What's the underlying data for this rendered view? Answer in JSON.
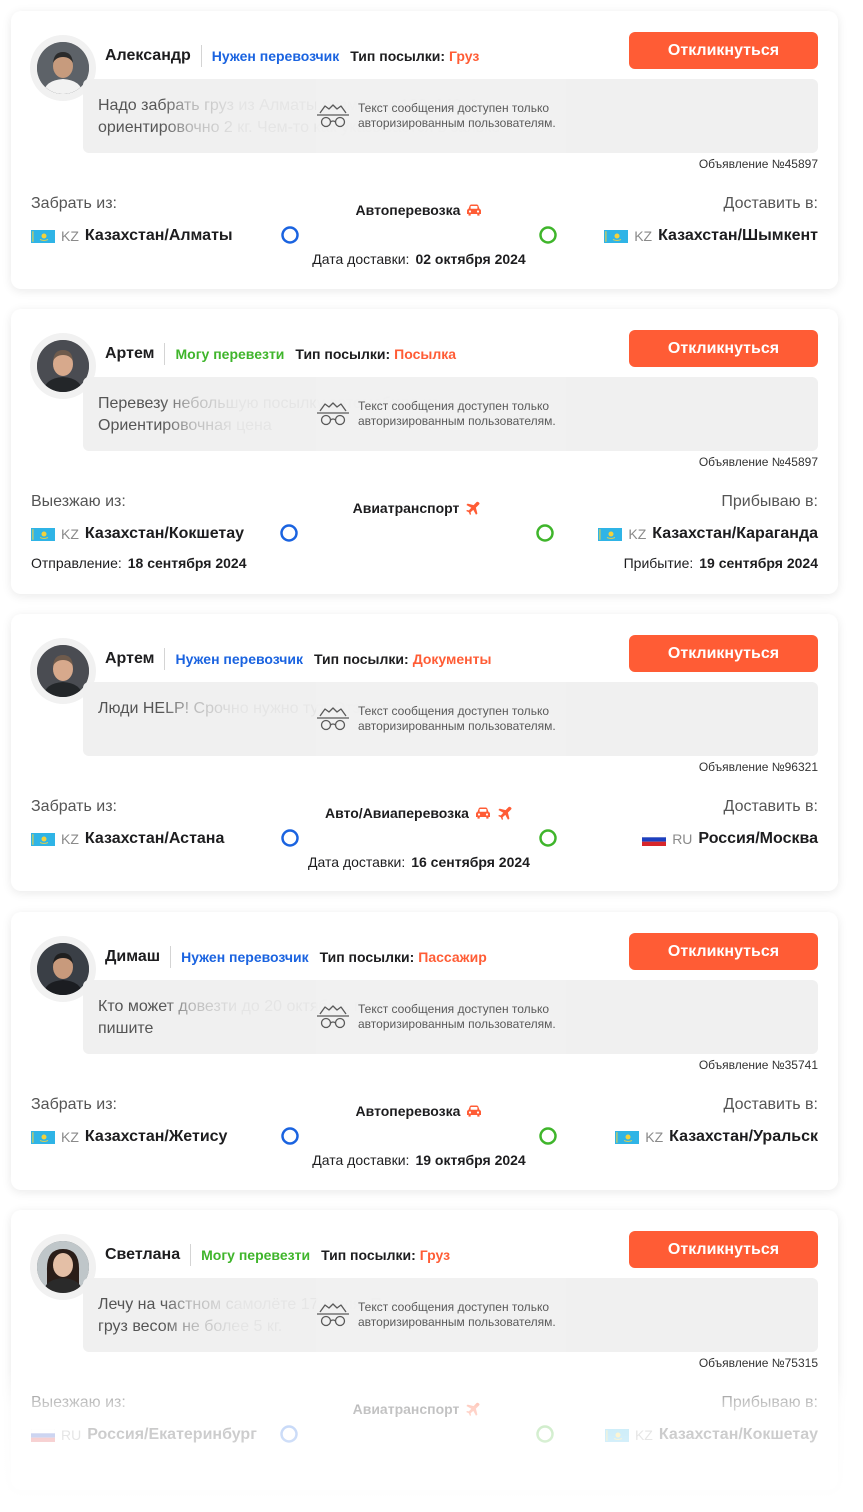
{
  "colors": {
    "accent": "#ff5c35",
    "blue_status": "#1a63e0",
    "green_status": "#3fb52b",
    "route_start": "#1a63e0",
    "route_end": "#3fb52b"
  },
  "lock_message": {
    "line1": "Текст сообщения доступен только",
    "line2": "авторизированным пользователям."
  },
  "respond_label": "Откликнуться",
  "package_type_label": "Тип посылки:",
  "listings": [
    {
      "name": "Александр",
      "status": "Нужен перевозчик",
      "status_color": "blue",
      "package_type": "Груз",
      "message_preview": "Надо забрать груз из Алматы                                                                              размером 180х140х1м",
      "message_line2": "ориентировочно 2 кг. Чем-то                                                                              как указывается в заявке",
      "ad_number": "Объявление №45897",
      "from_label": "Забрать из:",
      "to_label": "Доставить в:",
      "from": {
        "flag": "KZ",
        "code": "KZ",
        "city": "Казахстан/Алматы"
      },
      "to": {
        "flag": "KZ",
        "code": "KZ",
        "city": "Казахстан/Шымкент"
      },
      "transport": "Автоперевозка",
      "transport_icons": [
        "car-icon"
      ],
      "date_label": "Дата доставки:",
      "date": "02 октября 2024"
    },
    {
      "name": "Артем",
      "status": "Могу перевезти",
      "status_color": "green",
      "package_type": "Посылка",
      "message_preview": "Перевезу небольшую посылку                                                                             автомобиле из",
      "message_line2": "Ориентировочная цена                                                                              ",
      "ad_number": "Объявление №45897",
      "from_label": "Выезжаю из:",
      "to_label": "Прибываю в:",
      "from": {
        "flag": "KZ",
        "code": "KZ",
        "city": "Казахстан/Кокшетау"
      },
      "to": {
        "flag": "KZ",
        "code": "KZ",
        "city": "Казахстан/Караганда"
      },
      "transport": "Авиатранспорт",
      "transport_icons": [
        "plane-icon"
      ],
      "departure_label": "Отправление:",
      "departure": "18 сентября 2024",
      "arrival_label": "Прибытие:",
      "arrival": "19 сентября 2024"
    },
    {
      "name": "Артем",
      "status": "Нужен перевозчик",
      "status_color": "blue",
      "package_type": "Документы",
      "message_preview": "Люди HELP! Срочно нужно                                                                             тут. Отзовитесь",
      "message_line2": "",
      "ad_number": "Объявление №96321",
      "from_label": "Забрать из:",
      "to_label": "Доставить в:",
      "from": {
        "flag": "KZ",
        "code": "KZ",
        "city": "Казахстан/Астана"
      },
      "to": {
        "flag": "RU",
        "code": "RU",
        "city": "Россия/Москва"
      },
      "transport": "Авто/Авиаперевозка",
      "transport_icons": [
        "car-icon",
        "plane-icon"
      ],
      "date_label": "Дата доставки:",
      "date": "16 сентября 2024"
    },
    {
      "name": "Димаш",
      "status": "Нужен перевозчик",
      "status_color": "blue",
      "package_type": "Пассажир",
      "message_preview": "Кто может довезти до                                                                             20 октября, пишите мне",
      "message_line2": "пишите",
      "ad_number": "Объявление №35741",
      "from_label": "Забрать из:",
      "to_label": "Доставить в:",
      "from": {
        "flag": "KZ",
        "code": "KZ",
        "city": "Казахстан/Жетису"
      },
      "to": {
        "flag": "KZ",
        "code": "KZ",
        "city": "Казахстан/Уральск"
      },
      "transport": "Автоперевозка",
      "transport_icons": [
        "car-icon"
      ],
      "date_label": "Дата доставки:",
      "date": "19 октября 2024"
    },
    {
      "name": "Светлана",
      "status": "Могу перевезти",
      "status_color": "green",
      "package_type": "Груз",
      "message_preview": "Лечу на частном самолёте                                                                             17 июля. Перевезу",
      "message_line2": "груз весом не более 5 кг.",
      "ad_number": "Объявление №75315",
      "from_label": "Выезжаю из:",
      "to_label": "Прибываю в:",
      "from": {
        "flag": "RU",
        "code": "RU",
        "city": "Россия/Екатеринбург"
      },
      "to": {
        "flag": "KZ",
        "code": "KZ",
        "city": "Казахстан/Кокшетау"
      },
      "transport": "Авиатранспорт",
      "transport_icons": [
        "plane-icon"
      ]
    }
  ]
}
